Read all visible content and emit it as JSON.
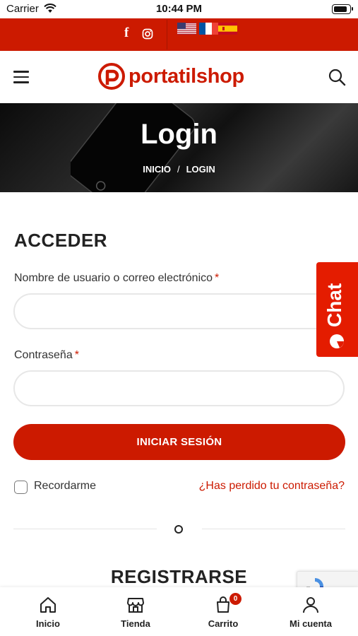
{
  "status_bar": {
    "carrier": "Carrier",
    "time": "10:44 PM",
    "battery_level": 0.9
  },
  "topbar": {
    "social": [
      "facebook-icon",
      "instagram-icon"
    ],
    "facebook_glyph": "f",
    "languages": [
      "en-US",
      "fr",
      "es"
    ]
  },
  "header": {
    "brand": "portatilshop",
    "menu_icon": "hamburger-icon",
    "search_icon": "search-icon"
  },
  "hero": {
    "title": "Login",
    "breadcrumb": {
      "home": "INICIO",
      "separator": "/",
      "current": "LOGIN"
    }
  },
  "login": {
    "title": "ACCEDER",
    "username_label": "Nombre de usuario o correo electrónico",
    "username_value": "",
    "password_label": "Contraseña",
    "password_value": "",
    "required_mark": "*",
    "submit_label": "INICIAR SESIÓN",
    "remember_label": "Recordarme",
    "remember_checked": false,
    "lost_password": "¿Has perdido tu contraseña?"
  },
  "register": {
    "title": "REGISTRARSE"
  },
  "chat": {
    "label": "Chat"
  },
  "bottom_nav": {
    "items": [
      {
        "label": "Inicio",
        "icon": "home-icon"
      },
      {
        "label": "Tienda",
        "icon": "store-icon"
      },
      {
        "label": "Carrito",
        "icon": "cart-icon",
        "badge": "0"
      },
      {
        "label": "Mi cuenta",
        "icon": "user-icon"
      }
    ]
  },
  "colors": {
    "brand_red": "#cc1a00",
    "chat_red": "#e41c00"
  }
}
